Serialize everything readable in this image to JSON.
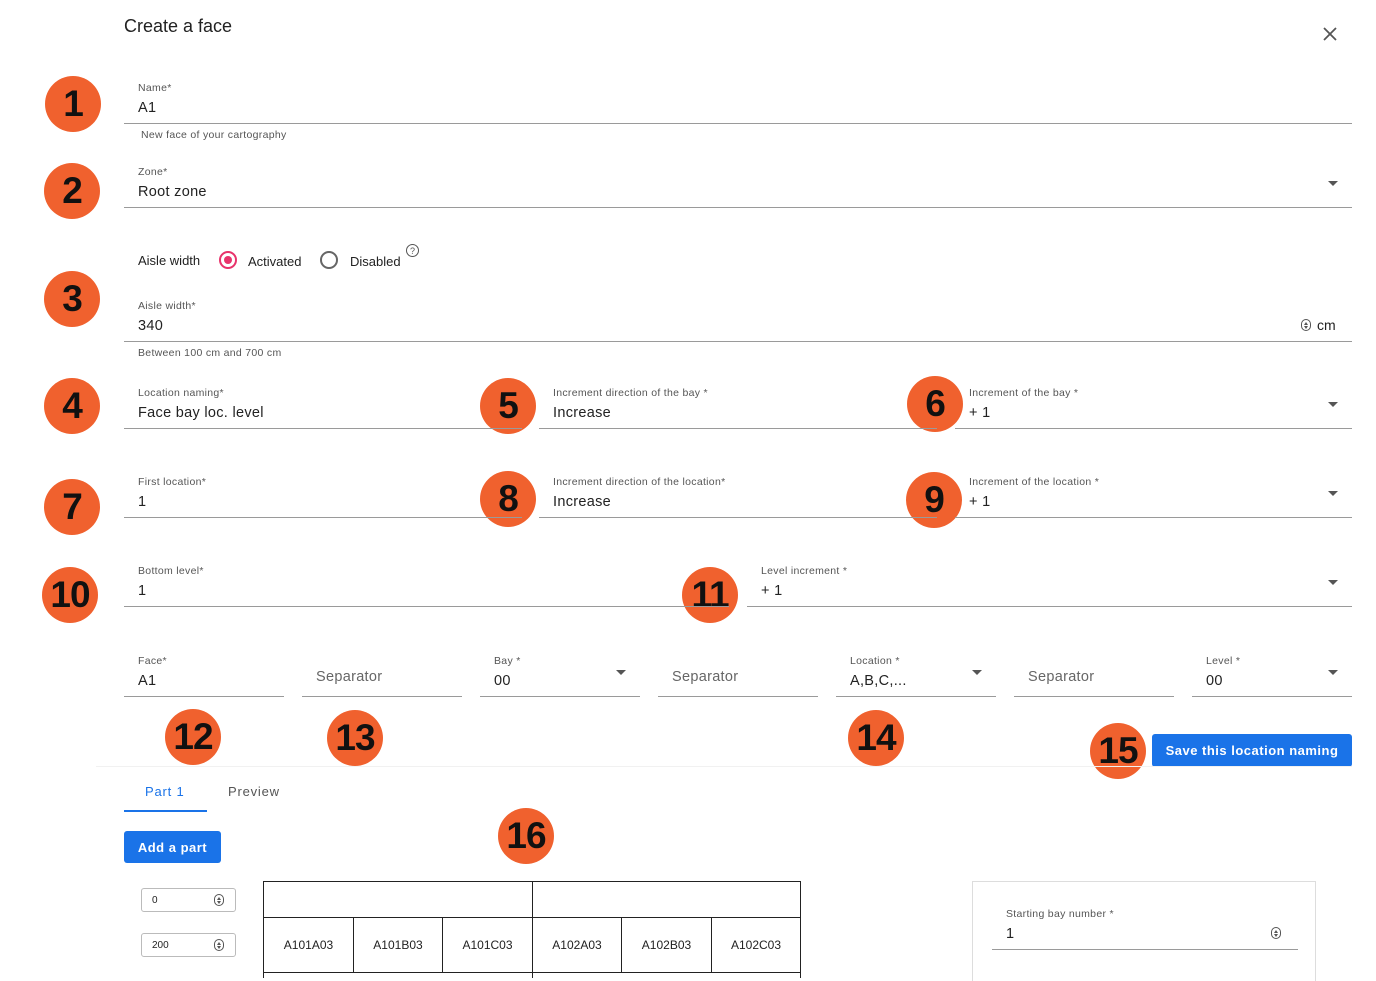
{
  "dialog": {
    "title": "Create a face",
    "close_icon": "close-icon"
  },
  "badges": [
    "1",
    "2",
    "3",
    "4",
    "5",
    "6",
    "7",
    "8",
    "9",
    "10",
    "11",
    "12",
    "13",
    "14",
    "15",
    "16"
  ],
  "name": {
    "label": "Name*",
    "value": "A1",
    "helper": "New face of your cartography"
  },
  "zone": {
    "label": "Zone*",
    "value": "Root zone"
  },
  "aisle": {
    "toggle_label": "Aisle width",
    "option_on": "Activated",
    "option_off": "Disabled",
    "selected": "Activated",
    "width_label": "Aisle width*",
    "width_value": "340",
    "unit": "cm",
    "helper": "Between 100 cm and 700 cm"
  },
  "location_naming": {
    "label": "Location naming*",
    "value": "Face bay loc. level"
  },
  "bay_direction": {
    "label": "Increment direction of the bay *",
    "value": "Increase"
  },
  "bay_increment": {
    "label": "Increment of the bay *",
    "value": "+ 1"
  },
  "first_location": {
    "label": "First location*",
    "value": "1"
  },
  "location_direction": {
    "label": "Increment direction of the location*",
    "value": "Increase"
  },
  "location_increment": {
    "label": "Increment of the location *",
    "value": "+ 1"
  },
  "bottom_level": {
    "label": "Bottom level*",
    "value": "1"
  },
  "level_increment": {
    "label": "Level increment *",
    "value": "+ 1"
  },
  "format": {
    "face": {
      "label": "Face*",
      "value": "A1"
    },
    "sep1": {
      "placeholder": "Separator"
    },
    "bay": {
      "label": "Bay *",
      "value": "00"
    },
    "sep2": {
      "placeholder": "Separator"
    },
    "location": {
      "label": "Location *",
      "value": "A,B,C,..."
    },
    "sep3": {
      "placeholder": "Separator"
    },
    "level": {
      "label": "Level *",
      "value": "00"
    }
  },
  "save_button": "Save this location naming",
  "tabs": [
    {
      "label": "Part 1",
      "active": true
    },
    {
      "label": "Preview",
      "active": false
    }
  ],
  "add_part_button": "Add a part",
  "range": {
    "min": "0",
    "max": "200"
  },
  "preview_cells": [
    "A101A03",
    "A101B03",
    "A101C03",
    "A102A03",
    "A102B03",
    "A102C03"
  ],
  "starting_bay": {
    "label": "Starting bay number *",
    "value": "1"
  },
  "colors": {
    "accent": "#1a73e8",
    "badge": "#f0612e",
    "radio": "#e8336b"
  }
}
